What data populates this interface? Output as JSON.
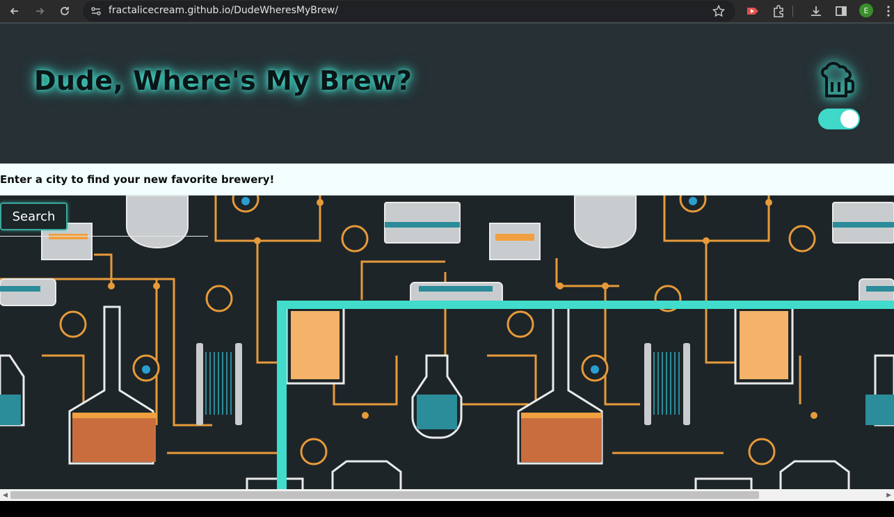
{
  "browser": {
    "url": "fractalicecream.github.io/DudeWheresMyBrew/",
    "profile_initial": "E",
    "icons": [
      "back-icon",
      "forward-icon",
      "reload-icon",
      "site-settings-icon",
      "bookmark-star-icon",
      "extension-red-icon",
      "extensions-puzzle-icon",
      "download-icon",
      "side-panel-icon",
      "menu-dots-icon"
    ]
  },
  "header": {
    "title": "Dude, Where's My Brew?",
    "icon": "beer-mug-icon",
    "toggle_state": "on"
  },
  "prompt": {
    "text": "Enter a city to find your new favorite brewery!"
  },
  "search": {
    "button_label": "Search",
    "input_value": ""
  },
  "colors": {
    "accent": "#41dccb",
    "header_bg": "#263035",
    "prompt_bg": "#f2fffe",
    "illustration_bg": "#1d2528",
    "pipe_orange": "#f0a040"
  }
}
